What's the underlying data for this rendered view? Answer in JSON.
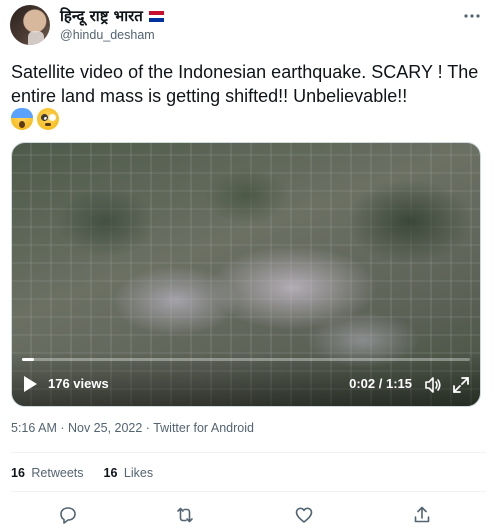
{
  "user": {
    "display_name": "हिन्दू राष्ट्र भारत",
    "handle": "@hindu_desham"
  },
  "tweet": {
    "text": "Satellite video of the Indonesian earthquake. SCARY ! The entire land mass is getting shifted!! Unbelievable!!",
    "emojis": [
      "face-screaming-in-fear-icon",
      "flushed-face-icon"
    ]
  },
  "video": {
    "views": "176 views",
    "time": "0:02 / 1:15",
    "progress": 0.027
  },
  "meta": {
    "timestamp": "5:16 AM · Nov 25, 2022 · Twitter for Android"
  },
  "stats": {
    "retweets_count": "16",
    "retweets_label": "Retweets",
    "likes_count": "16",
    "likes_label": "Likes"
  },
  "colors": {
    "text_primary": "#0f1419",
    "text_secondary": "#536471",
    "divider": "#eff3f4"
  }
}
